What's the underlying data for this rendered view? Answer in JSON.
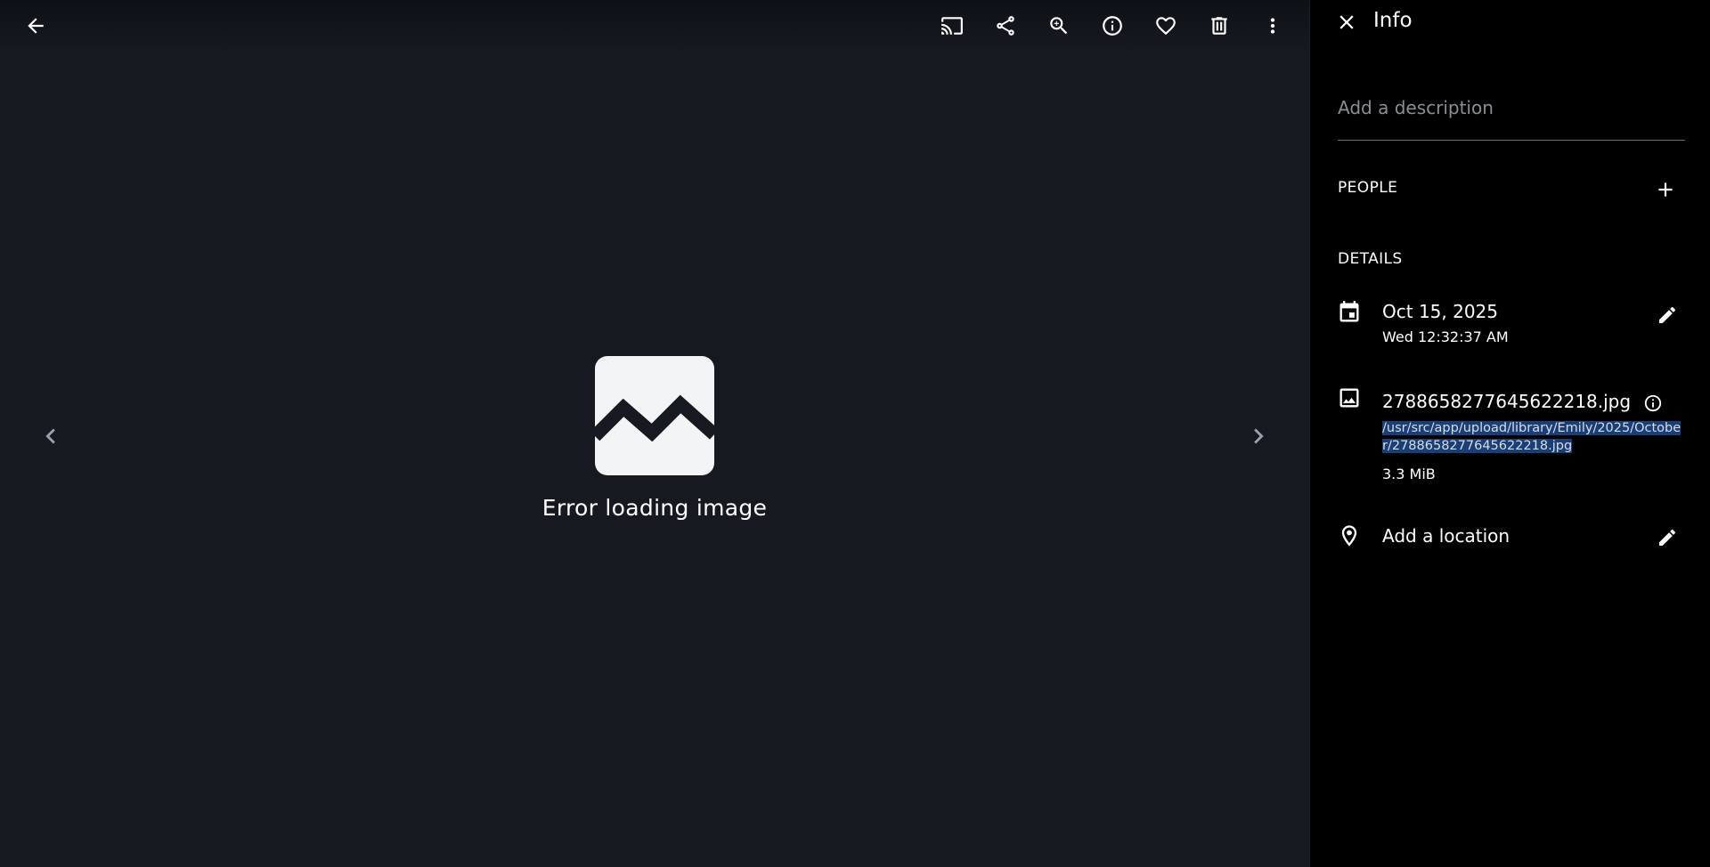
{
  "toolbar": {
    "back_icon": "arrow-left-icon",
    "actions": [
      {
        "name": "cast-icon"
      },
      {
        "name": "share-icon"
      },
      {
        "name": "zoom-in-icon"
      },
      {
        "name": "info-icon"
      },
      {
        "name": "favorite-icon"
      },
      {
        "name": "delete-icon"
      },
      {
        "name": "more-vertical-icon"
      }
    ]
  },
  "viewer": {
    "error_text": "Error loading image",
    "prev_icon": "chevron-left-icon",
    "next_icon": "chevron-right-icon"
  },
  "panel": {
    "title": "Info",
    "description_placeholder": "Add a description",
    "people_label": "PEOPLE",
    "details_label": "DETAILS",
    "date": "Oct 15, 2025",
    "datetime": "Wed 12:32:37 AM",
    "file_name": "2788658277645622218.jpg",
    "file_path": "/usr/src/app/upload/library/Emily/2025/October/2788658277645622218.jpg",
    "file_size": "3.3 MiB",
    "location": "Add a location"
  },
  "colors": {
    "viewer_bg": "#161a20",
    "panel_bg": "#000000",
    "selection_bg": "#1a3f78"
  }
}
